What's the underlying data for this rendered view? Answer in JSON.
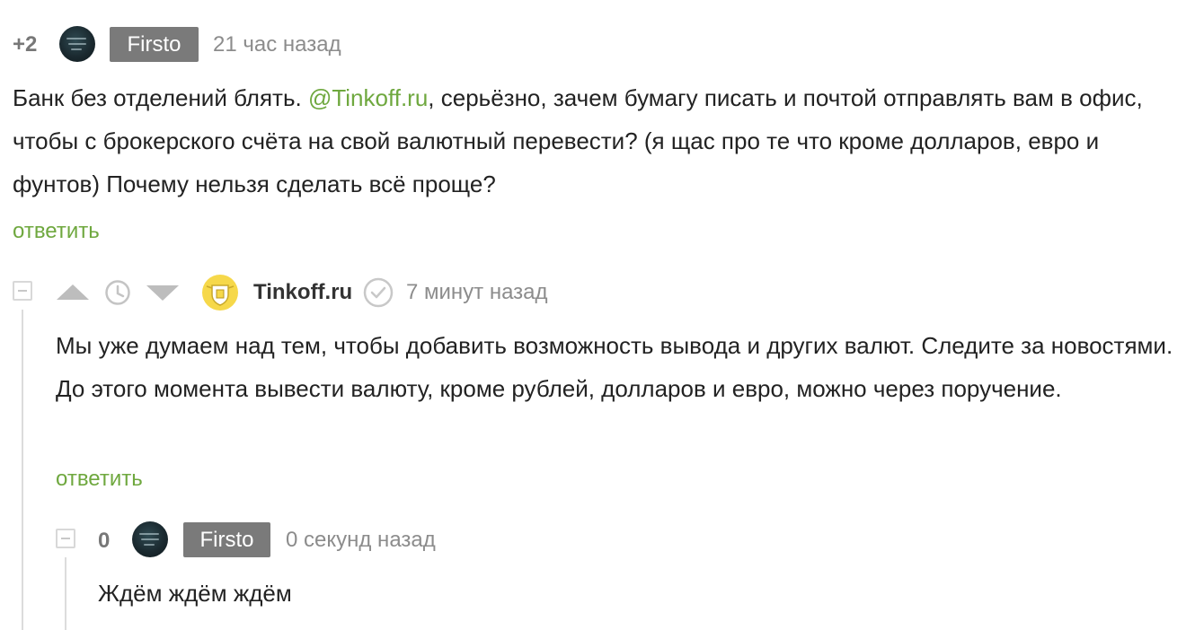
{
  "comment1": {
    "rating": "+2",
    "author": "Firsto",
    "time": "21 час назад",
    "text_before": "Банк без отделений блять. ",
    "mention": "@Tinkoff.ru",
    "text_after": ", серьёзно, зачем бумагу писать и почтой отправлять вам в офис, чтобы с брокерского счёта на свой валютный перевести? (я щас про те что кроме долларов, евро и фунтов) Почему нельзя сделать всё проще?",
    "reply_label": "ответить"
  },
  "comment2": {
    "author": "Tinkoff.ru",
    "time": "7 минут назад",
    "text": "Мы уже думаем над тем, чтобы добавить возможность вывода и других валют. Следите за новостями. До этого момента вывести валюту, кроме рублей, долларов и евро, можно через поручение.",
    "reply_label": "ответить"
  },
  "comment3": {
    "rating": "0",
    "author": "Firsto",
    "time": "0 секунд назад",
    "text": "Ждём ждём ждём"
  },
  "colors": {
    "link_green": "#6fa83f",
    "badge_gray": "#7a7a7a",
    "meta_gray": "#8c8c8c"
  }
}
